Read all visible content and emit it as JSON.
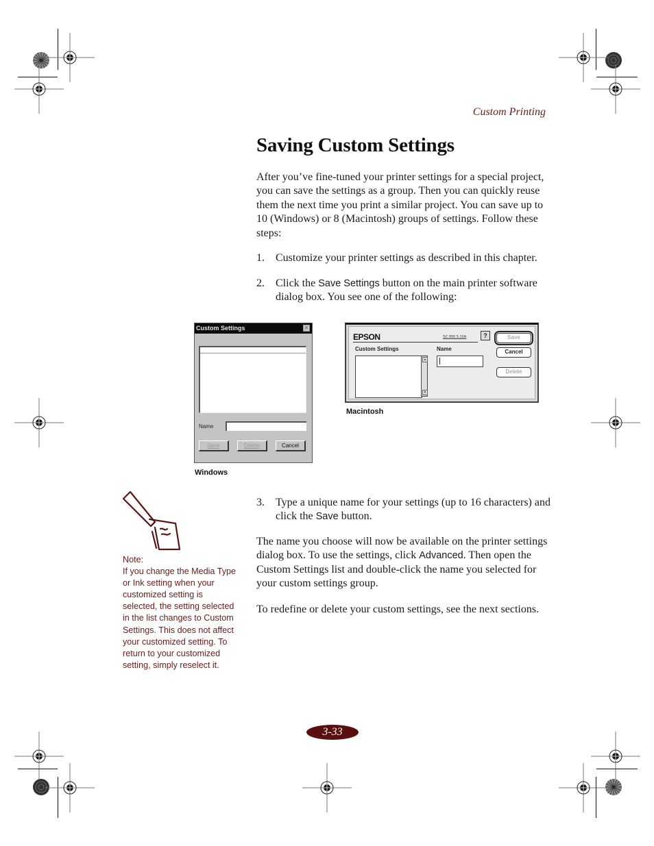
{
  "header": {
    "running_head": "Custom Printing"
  },
  "page_title": "Saving Custom Settings",
  "intro_paragraph": "After you’ve fine-tuned your printer settings for a special project, you can save the settings as a group. Then you can quickly reuse them the next time you print a similar project. You can save up to 10 (Windows) or 8 (Macintosh) groups of settings. Follow these steps:",
  "steps": [
    {
      "number": "1.",
      "text": "Customize your printer settings as described in this chapter."
    },
    {
      "number": "2.",
      "text_before": "Click the ",
      "ui_term": "Save Settings",
      "text_after": " button on the main printer software dialog box. You see one of the following:"
    },
    {
      "number": "3.",
      "text_before": "Type a unique name for your settings (up to 16 characters) and click the ",
      "ui_term": "Save",
      "text_after": " button."
    }
  ],
  "paragraph_after_steps": {
    "text_before": "The name you choose will now be available on the printer settings dialog box. To use the settings, click ",
    "ui_term": "Advanced",
    "text_after": ". Then open the Custom Settings list and double-click the name you selected for your custom settings group."
  },
  "closing_paragraph": "To redefine or delete your custom settings, see the next sections.",
  "windows_dialog": {
    "title": "Custom Settings",
    "close_glyph": "×",
    "name_label": "Name",
    "name_value": "",
    "buttons": {
      "save": "Save",
      "delete": "Delete",
      "cancel": "Cancel"
    },
    "caption": "Windows"
  },
  "mac_dialog": {
    "logo": "EPSON",
    "version": "SC 850 5.10A",
    "help_glyph": "?",
    "list_label": "Custom Settings",
    "name_label": "Name",
    "name_value": "",
    "scroll_up_glyph": "▲",
    "scroll_down_glyph": "▼",
    "buttons": {
      "save": "Save",
      "cancel": "Cancel",
      "delete": "Delete"
    },
    "caption": "Macintosh"
  },
  "note": {
    "heading": "Note:",
    "text": "If you change the Media Type or Ink setting when your customized setting is selected, the setting selected in the list changes to Custom Settings. This does not affect your customized setting. To return to your customized setting, simply reselect it."
  },
  "page_number": "3-33",
  "colors": {
    "accent": "#6b1a1a",
    "page_number_bg": "#5a0f0f"
  }
}
